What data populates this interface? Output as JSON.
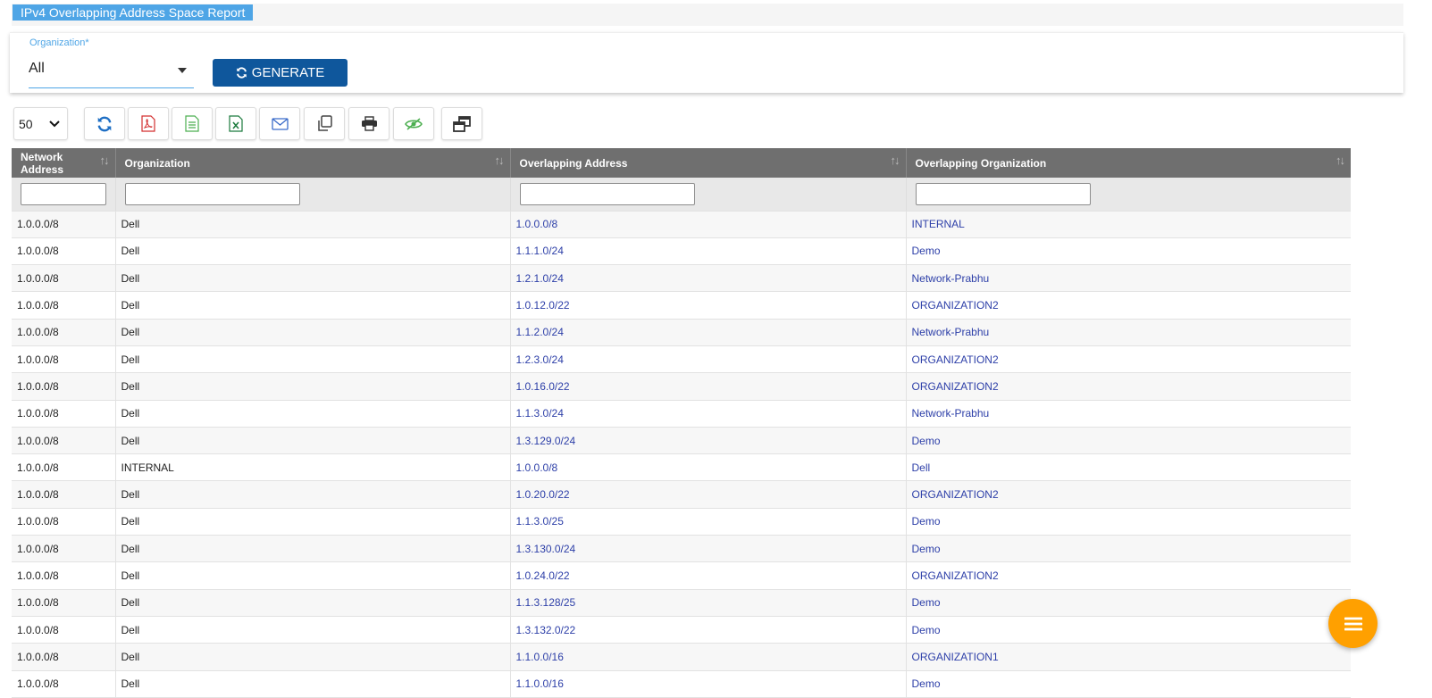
{
  "report": {
    "title": "IPv4 Overlapping Address Space Report"
  },
  "filter": {
    "organization_label": "Organization*",
    "organization_value": "All",
    "generate_label": "GENERATE"
  },
  "toolbar": {
    "page_size": "50",
    "buttons": [
      "refresh-icon",
      "pdf-icon",
      "csv-icon",
      "excel-icon",
      "email-icon",
      "copy-icon",
      "print-icon",
      "column-visibility-icon",
      "restore-window-icon"
    ]
  },
  "table": {
    "columns": [
      "Network Address",
      "Organization",
      "Overlapping Address",
      "Overlapping Organization"
    ],
    "rows": [
      [
        "1.0.0.0/8",
        "Dell",
        "1.0.0.0/8",
        "INTERNAL"
      ],
      [
        "1.0.0.0/8",
        "Dell",
        "1.1.1.0/24",
        "Demo"
      ],
      [
        "1.0.0.0/8",
        "Dell",
        "1.2.1.0/24",
        "Network-Prabhu"
      ],
      [
        "1.0.0.0/8",
        "Dell",
        "1.0.12.0/22",
        "ORGANIZATION2"
      ],
      [
        "1.0.0.0/8",
        "Dell",
        "1.1.2.0/24",
        "Network-Prabhu"
      ],
      [
        "1.0.0.0/8",
        "Dell",
        "1.2.3.0/24",
        "ORGANIZATION2"
      ],
      [
        "1.0.0.0/8",
        "Dell",
        "1.0.16.0/22",
        "ORGANIZATION2"
      ],
      [
        "1.0.0.0/8",
        "Dell",
        "1.1.3.0/24",
        "Network-Prabhu"
      ],
      [
        "1.0.0.0/8",
        "Dell",
        "1.3.129.0/24",
        "Demo"
      ],
      [
        "1.0.0.0/8",
        "INTERNAL",
        "1.0.0.0/8",
        "Dell"
      ],
      [
        "1.0.0.0/8",
        "Dell",
        "1.0.20.0/22",
        "ORGANIZATION2"
      ],
      [
        "1.0.0.0/8",
        "Dell",
        "1.1.3.0/25",
        "Demo"
      ],
      [
        "1.0.0.0/8",
        "Dell",
        "1.3.130.0/24",
        "Demo"
      ],
      [
        "1.0.0.0/8",
        "Dell",
        "1.0.24.0/22",
        "ORGANIZATION2"
      ],
      [
        "1.0.0.0/8",
        "Dell",
        "1.1.3.128/25",
        "Demo"
      ],
      [
        "1.0.0.0/8",
        "Dell",
        "1.3.132.0/22",
        "Demo"
      ],
      [
        "1.0.0.0/8",
        "Dell",
        "1.1.0.0/16",
        "ORGANIZATION1"
      ],
      [
        "1.0.0.0/8",
        "Dell",
        "1.1.0.0/16",
        "Demo"
      ]
    ]
  },
  "colors": {
    "header_bg": "#6f6f6f",
    "primary": "#0f579c",
    "accent": "#4ea5e6",
    "link": "#2d3fa8",
    "fab": "#ffa000"
  }
}
